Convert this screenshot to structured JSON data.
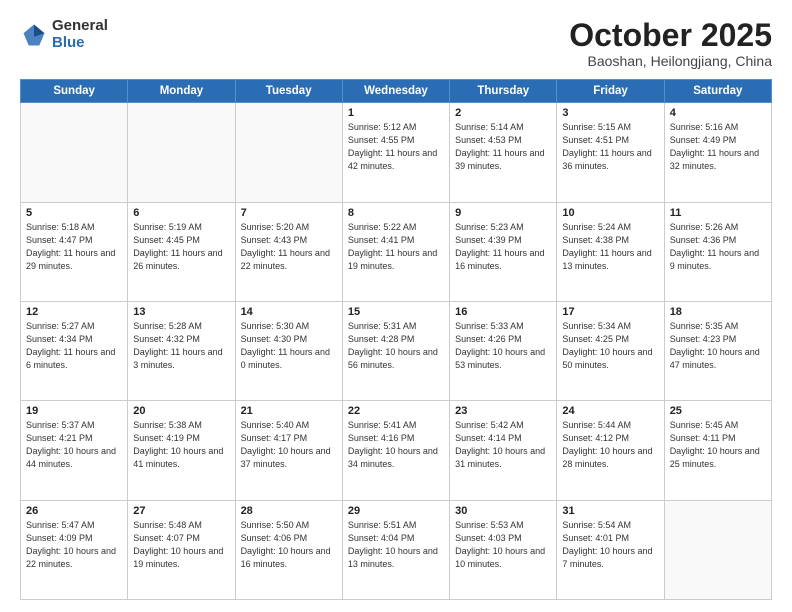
{
  "logo": {
    "general": "General",
    "blue": "Blue"
  },
  "header": {
    "month": "October 2025",
    "location": "Baoshan, Heilongjiang, China"
  },
  "weekdays": [
    "Sunday",
    "Monday",
    "Tuesday",
    "Wednesday",
    "Thursday",
    "Friday",
    "Saturday"
  ],
  "weeks": [
    [
      {
        "day": "",
        "info": ""
      },
      {
        "day": "",
        "info": ""
      },
      {
        "day": "",
        "info": ""
      },
      {
        "day": "1",
        "info": "Sunrise: 5:12 AM\nSunset: 4:55 PM\nDaylight: 11 hours\nand 42 minutes."
      },
      {
        "day": "2",
        "info": "Sunrise: 5:14 AM\nSunset: 4:53 PM\nDaylight: 11 hours\nand 39 minutes."
      },
      {
        "day": "3",
        "info": "Sunrise: 5:15 AM\nSunset: 4:51 PM\nDaylight: 11 hours\nand 36 minutes."
      },
      {
        "day": "4",
        "info": "Sunrise: 5:16 AM\nSunset: 4:49 PM\nDaylight: 11 hours\nand 32 minutes."
      }
    ],
    [
      {
        "day": "5",
        "info": "Sunrise: 5:18 AM\nSunset: 4:47 PM\nDaylight: 11 hours\nand 29 minutes."
      },
      {
        "day": "6",
        "info": "Sunrise: 5:19 AM\nSunset: 4:45 PM\nDaylight: 11 hours\nand 26 minutes."
      },
      {
        "day": "7",
        "info": "Sunrise: 5:20 AM\nSunset: 4:43 PM\nDaylight: 11 hours\nand 22 minutes."
      },
      {
        "day": "8",
        "info": "Sunrise: 5:22 AM\nSunset: 4:41 PM\nDaylight: 11 hours\nand 19 minutes."
      },
      {
        "day": "9",
        "info": "Sunrise: 5:23 AM\nSunset: 4:39 PM\nDaylight: 11 hours\nand 16 minutes."
      },
      {
        "day": "10",
        "info": "Sunrise: 5:24 AM\nSunset: 4:38 PM\nDaylight: 11 hours\nand 13 minutes."
      },
      {
        "day": "11",
        "info": "Sunrise: 5:26 AM\nSunset: 4:36 PM\nDaylight: 11 hours\nand 9 minutes."
      }
    ],
    [
      {
        "day": "12",
        "info": "Sunrise: 5:27 AM\nSunset: 4:34 PM\nDaylight: 11 hours\nand 6 minutes."
      },
      {
        "day": "13",
        "info": "Sunrise: 5:28 AM\nSunset: 4:32 PM\nDaylight: 11 hours\nand 3 minutes."
      },
      {
        "day": "14",
        "info": "Sunrise: 5:30 AM\nSunset: 4:30 PM\nDaylight: 11 hours\nand 0 minutes."
      },
      {
        "day": "15",
        "info": "Sunrise: 5:31 AM\nSunset: 4:28 PM\nDaylight: 10 hours\nand 56 minutes."
      },
      {
        "day": "16",
        "info": "Sunrise: 5:33 AM\nSunset: 4:26 PM\nDaylight: 10 hours\nand 53 minutes."
      },
      {
        "day": "17",
        "info": "Sunrise: 5:34 AM\nSunset: 4:25 PM\nDaylight: 10 hours\nand 50 minutes."
      },
      {
        "day": "18",
        "info": "Sunrise: 5:35 AM\nSunset: 4:23 PM\nDaylight: 10 hours\nand 47 minutes."
      }
    ],
    [
      {
        "day": "19",
        "info": "Sunrise: 5:37 AM\nSunset: 4:21 PM\nDaylight: 10 hours\nand 44 minutes."
      },
      {
        "day": "20",
        "info": "Sunrise: 5:38 AM\nSunset: 4:19 PM\nDaylight: 10 hours\nand 41 minutes."
      },
      {
        "day": "21",
        "info": "Sunrise: 5:40 AM\nSunset: 4:17 PM\nDaylight: 10 hours\nand 37 minutes."
      },
      {
        "day": "22",
        "info": "Sunrise: 5:41 AM\nSunset: 4:16 PM\nDaylight: 10 hours\nand 34 minutes."
      },
      {
        "day": "23",
        "info": "Sunrise: 5:42 AM\nSunset: 4:14 PM\nDaylight: 10 hours\nand 31 minutes."
      },
      {
        "day": "24",
        "info": "Sunrise: 5:44 AM\nSunset: 4:12 PM\nDaylight: 10 hours\nand 28 minutes."
      },
      {
        "day": "25",
        "info": "Sunrise: 5:45 AM\nSunset: 4:11 PM\nDaylight: 10 hours\nand 25 minutes."
      }
    ],
    [
      {
        "day": "26",
        "info": "Sunrise: 5:47 AM\nSunset: 4:09 PM\nDaylight: 10 hours\nand 22 minutes."
      },
      {
        "day": "27",
        "info": "Sunrise: 5:48 AM\nSunset: 4:07 PM\nDaylight: 10 hours\nand 19 minutes."
      },
      {
        "day": "28",
        "info": "Sunrise: 5:50 AM\nSunset: 4:06 PM\nDaylight: 10 hours\nand 16 minutes."
      },
      {
        "day": "29",
        "info": "Sunrise: 5:51 AM\nSunset: 4:04 PM\nDaylight: 10 hours\nand 13 minutes."
      },
      {
        "day": "30",
        "info": "Sunrise: 5:53 AM\nSunset: 4:03 PM\nDaylight: 10 hours\nand 10 minutes."
      },
      {
        "day": "31",
        "info": "Sunrise: 5:54 AM\nSunset: 4:01 PM\nDaylight: 10 hours\nand 7 minutes."
      },
      {
        "day": "",
        "info": ""
      }
    ]
  ]
}
